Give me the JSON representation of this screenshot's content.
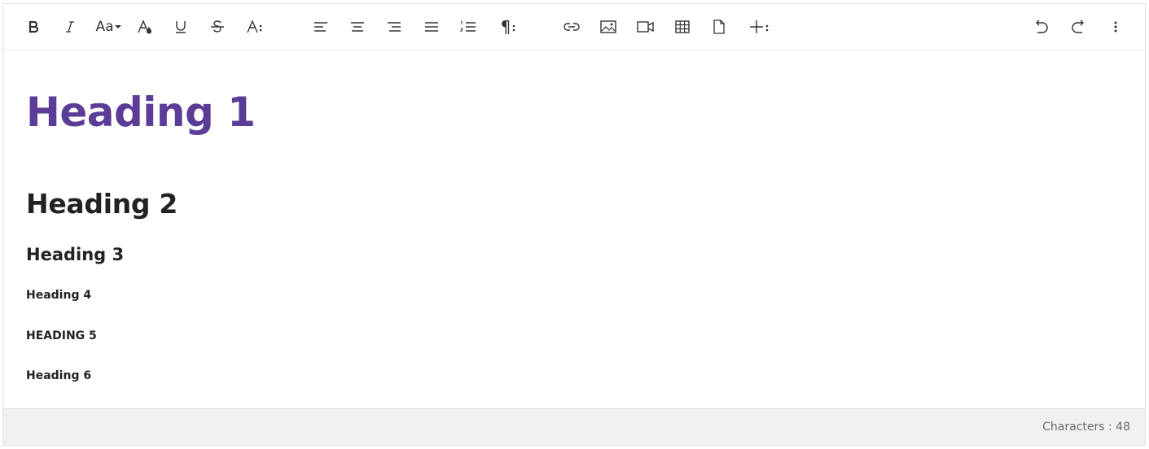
{
  "toolbar": {
    "font_size_label": "Aa",
    "paragraph_label": "¶"
  },
  "content": {
    "h1": "Heading 1",
    "h2": "Heading 2",
    "h3": "Heading 3",
    "h4": "Heading 4",
    "h5": "Heading 5",
    "h6": "Heading 6"
  },
  "footer": {
    "char_count": "Characters : 48"
  },
  "colors": {
    "heading1": "#5b3c96",
    "footer_bg": "#f1f1f1"
  }
}
